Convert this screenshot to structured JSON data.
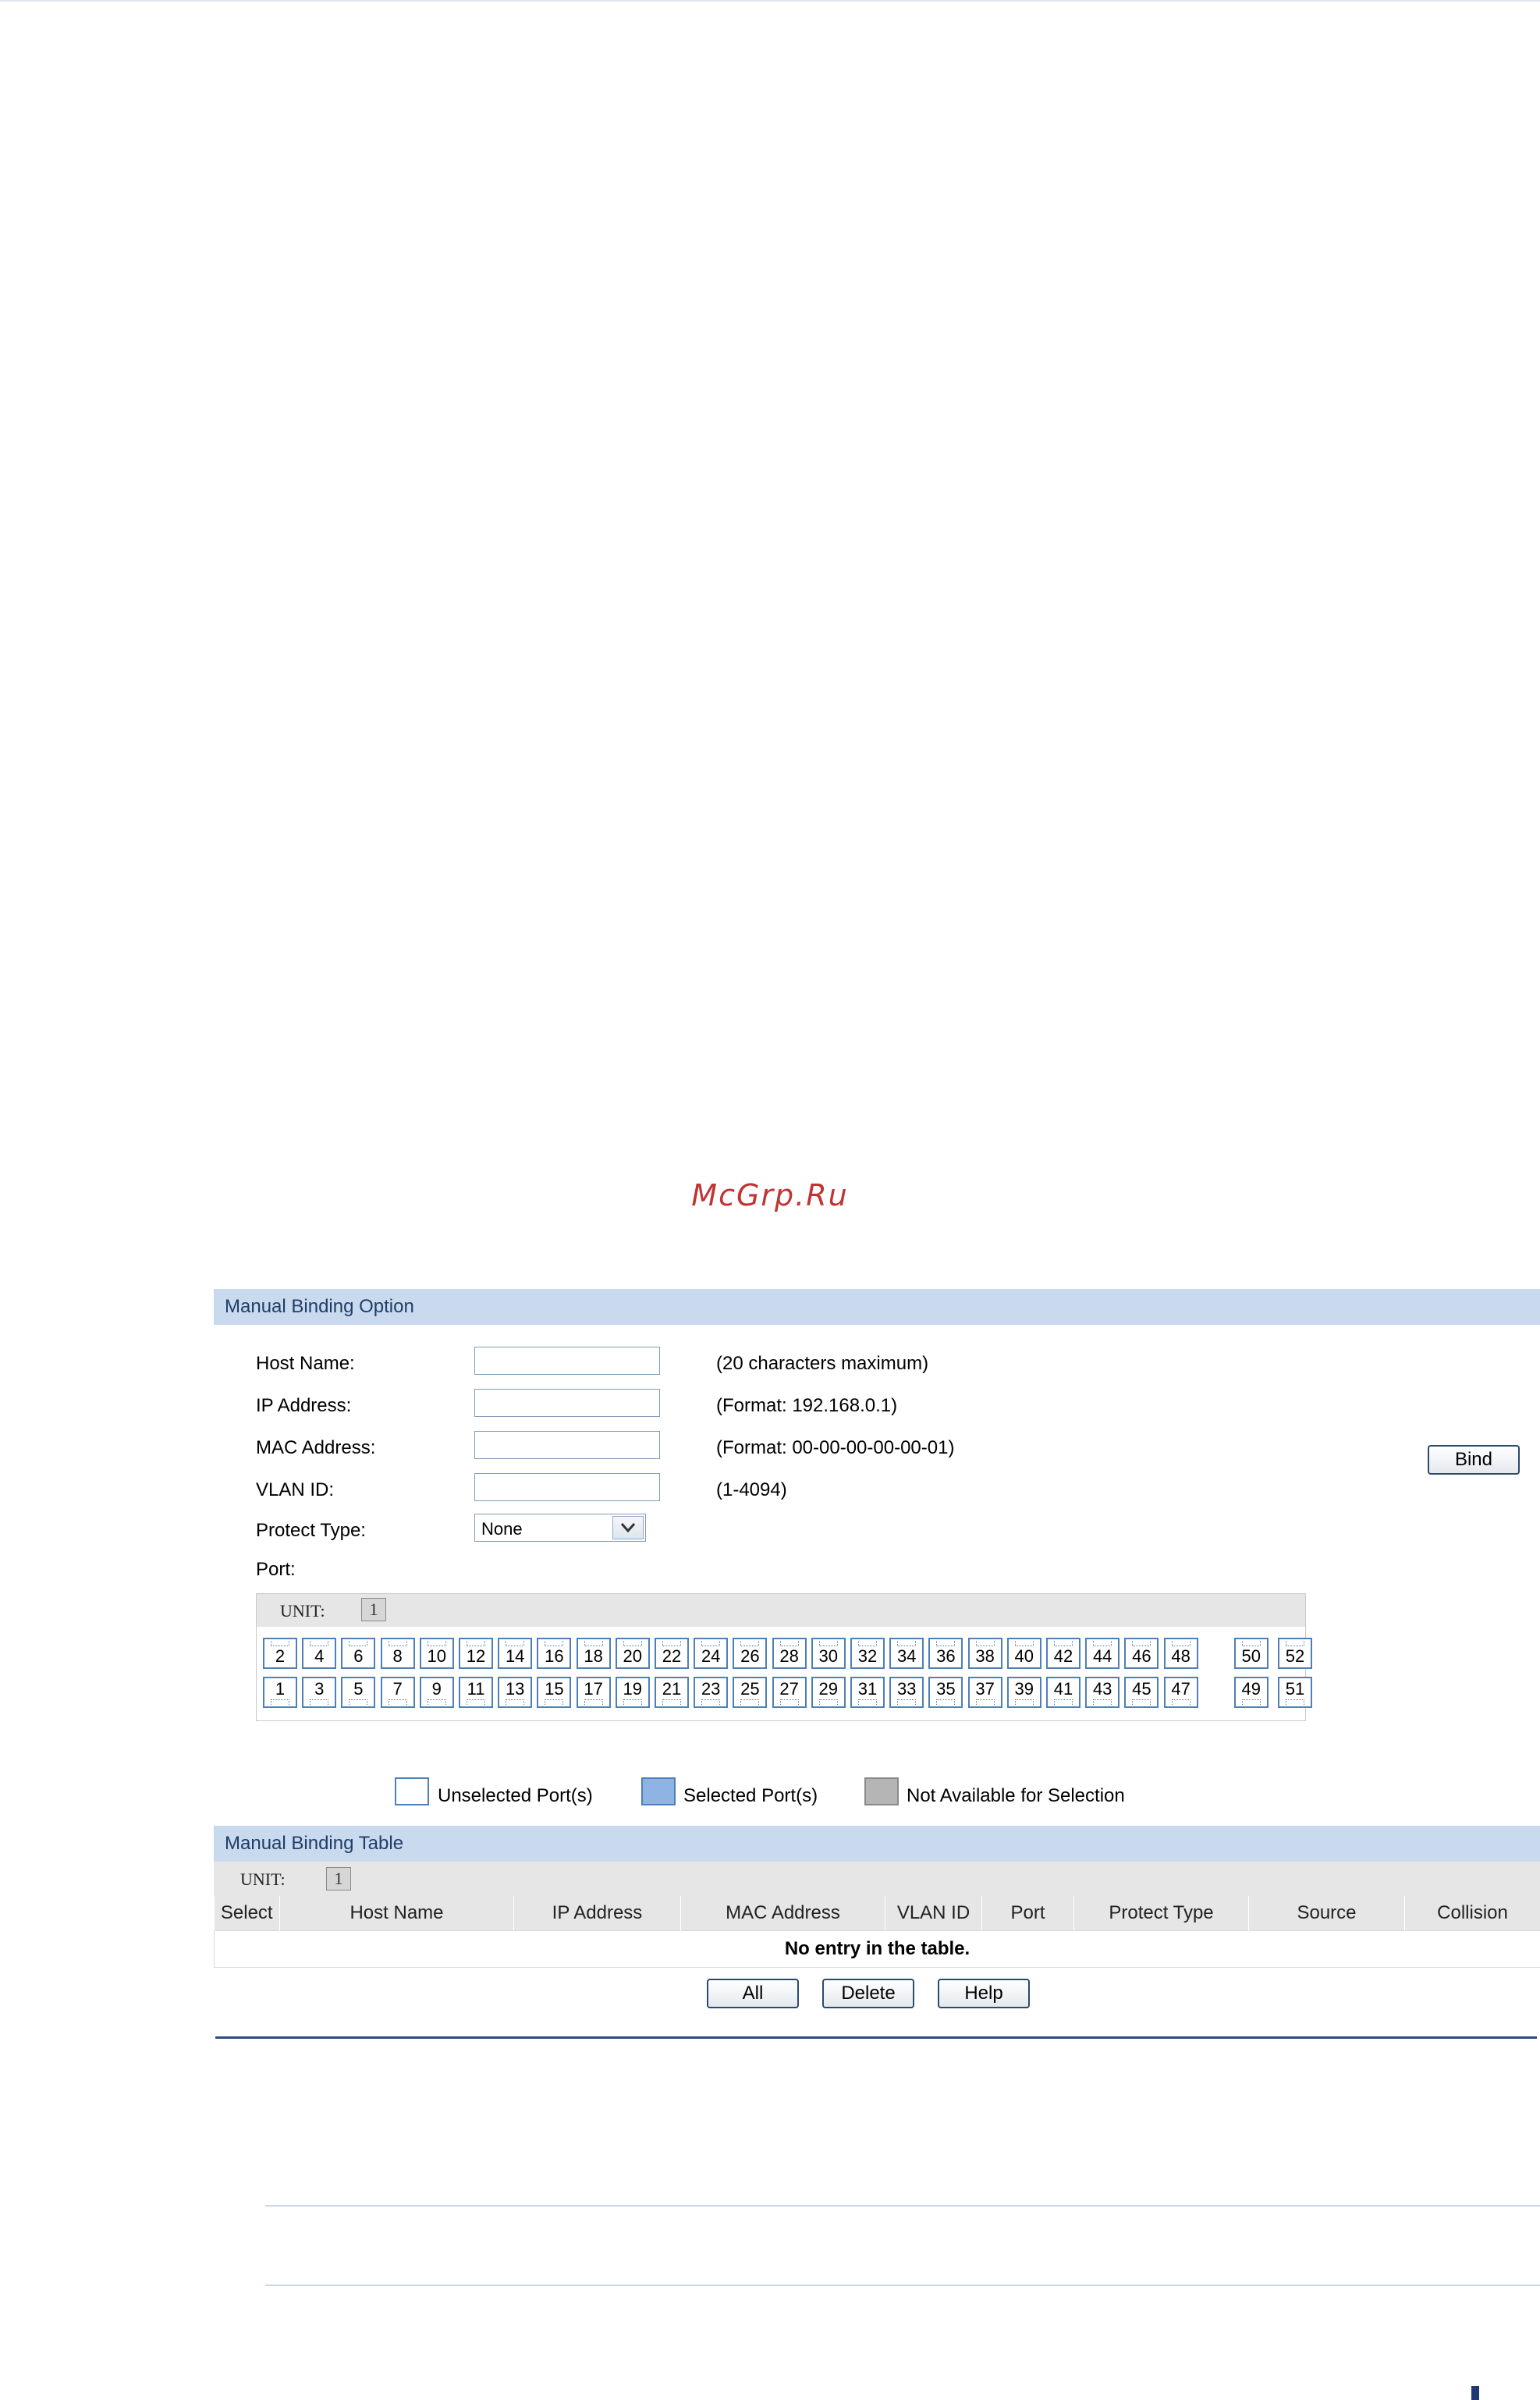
{
  "watermark": "McGrp.Ru",
  "manual_binding_option": {
    "title": "Manual Binding Option",
    "fields": [
      {
        "label": "Host Name:",
        "value": "",
        "hint": "(20 characters maximum)"
      },
      {
        "label": "IP Address:",
        "value": "",
        "hint": "(Format: 192.168.0.1)"
      },
      {
        "label": "MAC Address:",
        "value": "",
        "hint": "(Format: 00-00-00-00-00-01)"
      },
      {
        "label": "VLAN ID:",
        "value": "",
        "hint": "(1-4094)"
      }
    ],
    "protect_type": {
      "label": "Protect Type:",
      "selected": "None"
    },
    "port_label": "Port:",
    "bind_button": "Bind",
    "unit_label": "UNIT:",
    "unit_value": "1",
    "ports_top": [
      "2",
      "4",
      "6",
      "8",
      "10",
      "12",
      "14",
      "16",
      "18",
      "20",
      "22",
      "24",
      "26",
      "28",
      "30",
      "32",
      "34",
      "36",
      "38",
      "40",
      "42",
      "44",
      "46",
      "48",
      "50",
      "52"
    ],
    "ports_bottom": [
      "1",
      "3",
      "5",
      "7",
      "9",
      "11",
      "13",
      "15",
      "17",
      "19",
      "21",
      "23",
      "25",
      "27",
      "29",
      "31",
      "33",
      "35",
      "37",
      "39",
      "41",
      "43",
      "45",
      "47",
      "49",
      "51"
    ]
  },
  "legend": {
    "unselected": "Unselected Port(s)",
    "selected": "Selected Port(s)",
    "not_available": "Not Available for Selection"
  },
  "manual_binding_table": {
    "title": "Manual Binding Table",
    "unit_label": "UNIT:",
    "unit_value": "1",
    "columns": [
      "Select",
      "Host Name",
      "IP Address",
      "MAC Address",
      "VLAN ID",
      "Port",
      "Protect Type",
      "Source",
      "Collision"
    ],
    "empty_message": "No entry in the table.",
    "buttons": {
      "all": "All",
      "delete": "Delete",
      "help": "Help"
    }
  },
  "colors": {
    "header_bg": "#c9d9ee",
    "header_text": "#1f3e68",
    "port_border": "#4f7fb8",
    "selected_port": "#8fb4e3",
    "unavailable_port": "#b5b5b5",
    "watermark": "#c23434"
  }
}
